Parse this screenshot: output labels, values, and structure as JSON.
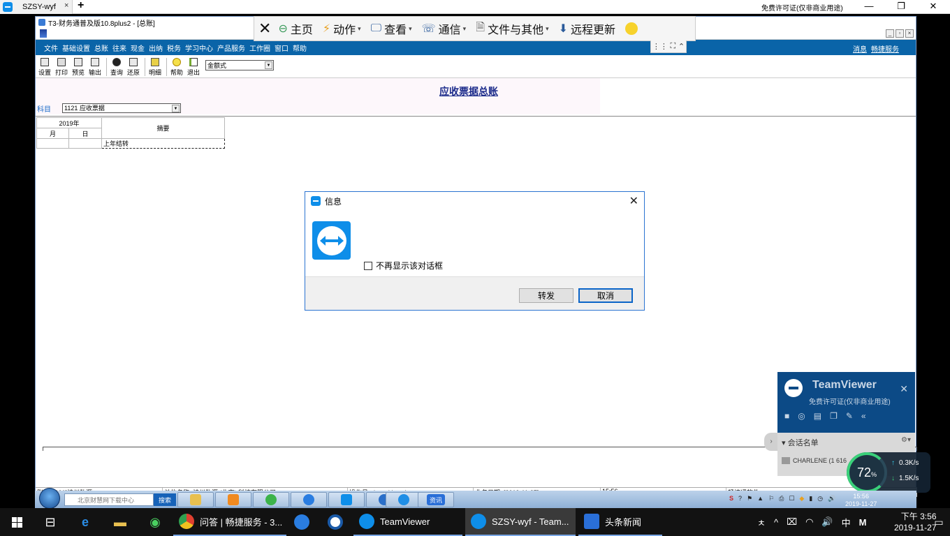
{
  "host_tabs": {
    "active_tab": "SZSY-wyf",
    "close_glyph": "×",
    "new_tab_glyph": "+",
    "license_notice": "免费许可证(仅非商业用途)",
    "window_controls": [
      "—",
      "❐",
      "✕"
    ]
  },
  "remote_toolbar": {
    "close_glyph": "✕",
    "items": [
      {
        "label": "主页",
        "icon": "home-icon",
        "glyph": "⊖",
        "caret": false
      },
      {
        "label": "动作",
        "icon": "lightning-icon",
        "glyph": "⚡",
        "caret": true
      },
      {
        "label": "查看",
        "icon": "monitor-icon",
        "glyph": "🖵",
        "caret": true
      },
      {
        "label": "通信",
        "icon": "phone-icon",
        "glyph": "☏",
        "caret": true
      },
      {
        "label": "文件与其他",
        "icon": "file-icon",
        "glyph": "🗎",
        "caret": true
      },
      {
        "label": "远程更新",
        "icon": "download-icon",
        "glyph": "⬇",
        "caret": false
      }
    ],
    "caret_glyph": "▾",
    "tab_glyphs": [
      "⋮⋮",
      "⛶",
      "⌃"
    ]
  },
  "t3": {
    "window_title": "T3-财务通普及版10.8plus2 - [总账]",
    "menu": [
      "文件",
      "基础设置",
      "总账",
      "往来",
      "现金",
      "出纳",
      "税务",
      "学习中心",
      "产品服务",
      "工作圈",
      "窗口",
      "帮助"
    ],
    "menu_right": [
      "消息",
      "畅捷服务"
    ],
    "mdi_controls": [
      "_",
      "▫",
      "×"
    ],
    "toolbar": [
      {
        "label": "设置",
        "icon": "settings-icon"
      },
      {
        "label": "打印",
        "icon": "print-icon"
      },
      {
        "label": "预览",
        "icon": "preview-icon"
      },
      {
        "label": "输出",
        "icon": "export-icon"
      },
      {
        "label": "查询",
        "icon": "query-icon"
      },
      {
        "label": "还原",
        "icon": "restore-icon"
      },
      {
        "label": "明细",
        "icon": "detail-icon"
      },
      {
        "label": "帮助",
        "icon": "help-icon"
      },
      {
        "label": "退出",
        "icon": "exit-icon"
      }
    ],
    "format_select": "金额式",
    "report_title": "应收票据总账",
    "subject_label": "科目",
    "subject_value": "1121 应收票据",
    "table": {
      "year": "2019年",
      "month": "月",
      "day": "日",
      "summary_header": "摘要",
      "row1_summary": "上年结转"
    },
    "status": {
      "account_set": "账套: [001]神州数源",
      "company": "单位名称: 神州数源 (北京) 科技有限公司",
      "operator": "操作员: demo(demo)",
      "business_date": "业务日期: [2019-11-27]",
      "time": "15:56",
      "vendor": "畅捷通软件"
    }
  },
  "dialog": {
    "title": "信息",
    "close_glyph": "✕",
    "checkbox_label": "不再显示该对话框",
    "checkbox_checked": false,
    "forward_button": "转发",
    "cancel_button": "取消"
  },
  "tv_panel": {
    "brand": "TeamViewer",
    "license": "免费许可证(仅非商业用途)",
    "close_glyph": "✕",
    "tools": [
      "■",
      "◎",
      "▤",
      "❐",
      "✎",
      "«"
    ],
    "tab_glyph": "›",
    "session_header": "会话名单",
    "session_header_glyph": "▾",
    "session_gear": "⚙▾",
    "session_user": "CHARLENE (1 616"
  },
  "net_widget": {
    "percent": "72",
    "percent_unit": "%",
    "upload": "0.3K/s",
    "download": "1.5K/s",
    "up_glyph": "↑",
    "down_glyph": "↓"
  },
  "remote_taskbar": {
    "search_placeholder": "北京财慧网下载中心",
    "search_button": "搜索",
    "apps": [
      {
        "icon": "folder-icon",
        "color": "#e8c050",
        "label": ""
      },
      {
        "icon": "media-player-icon",
        "color": "#f08a20",
        "label": ""
      },
      {
        "icon": "wechat-icon",
        "color": "#3cb34a",
        "label": ""
      },
      {
        "icon": "sogou-icon",
        "color": "#2a7de1",
        "label": ""
      },
      {
        "icon": "teamviewer-icon",
        "color": "#0e8ee9",
        "label": ""
      },
      {
        "icon": "ie-update-icon",
        "color": "#2a6fc9",
        "label": ""
      },
      {
        "icon": "ie-icon",
        "color": "#1f8ee6",
        "label": ""
      },
      {
        "icon": "news-icon",
        "color": "#2a6fd8",
        "label": "资讯"
      }
    ],
    "tray": [
      "S",
      "?",
      "⚑",
      "▲",
      "⚐",
      "⎙",
      "☐",
      "◆",
      "▮",
      "◷",
      "🔊"
    ],
    "clock_time": "15:56",
    "clock_date": "2019-11-27"
  },
  "taskbar": {
    "tasks": [
      {
        "label": "问答 | 畅捷服务 - 3...",
        "icon": "chrome-icon",
        "color": "#e0a030",
        "state": "running"
      },
      {
        "label": "",
        "icon": "sogou-icon",
        "color": "#2a7de1",
        "state": "pinned"
      },
      {
        "label": "",
        "icon": "quicktime-icon",
        "color": "#ffffff",
        "state": "pinned"
      },
      {
        "label": "TeamViewer",
        "icon": "teamviewer-icon",
        "color": "#0e8ee9",
        "state": "running"
      },
      {
        "label": "SZSY-wyf - Team...",
        "icon": "teamviewer-icon",
        "color": "#0e8ee9",
        "state": "active"
      },
      {
        "label": "头条新闻",
        "icon": "news-icon",
        "color": "#2a6fd8",
        "state": "running"
      }
    ],
    "tray": [
      "ㅊ",
      "^",
      "⌧",
      "◠",
      "🔊",
      "中",
      "M"
    ],
    "clock_time": "下午 3:56",
    "clock_date": "2019-11-27",
    "notification_glyph": "▭"
  }
}
